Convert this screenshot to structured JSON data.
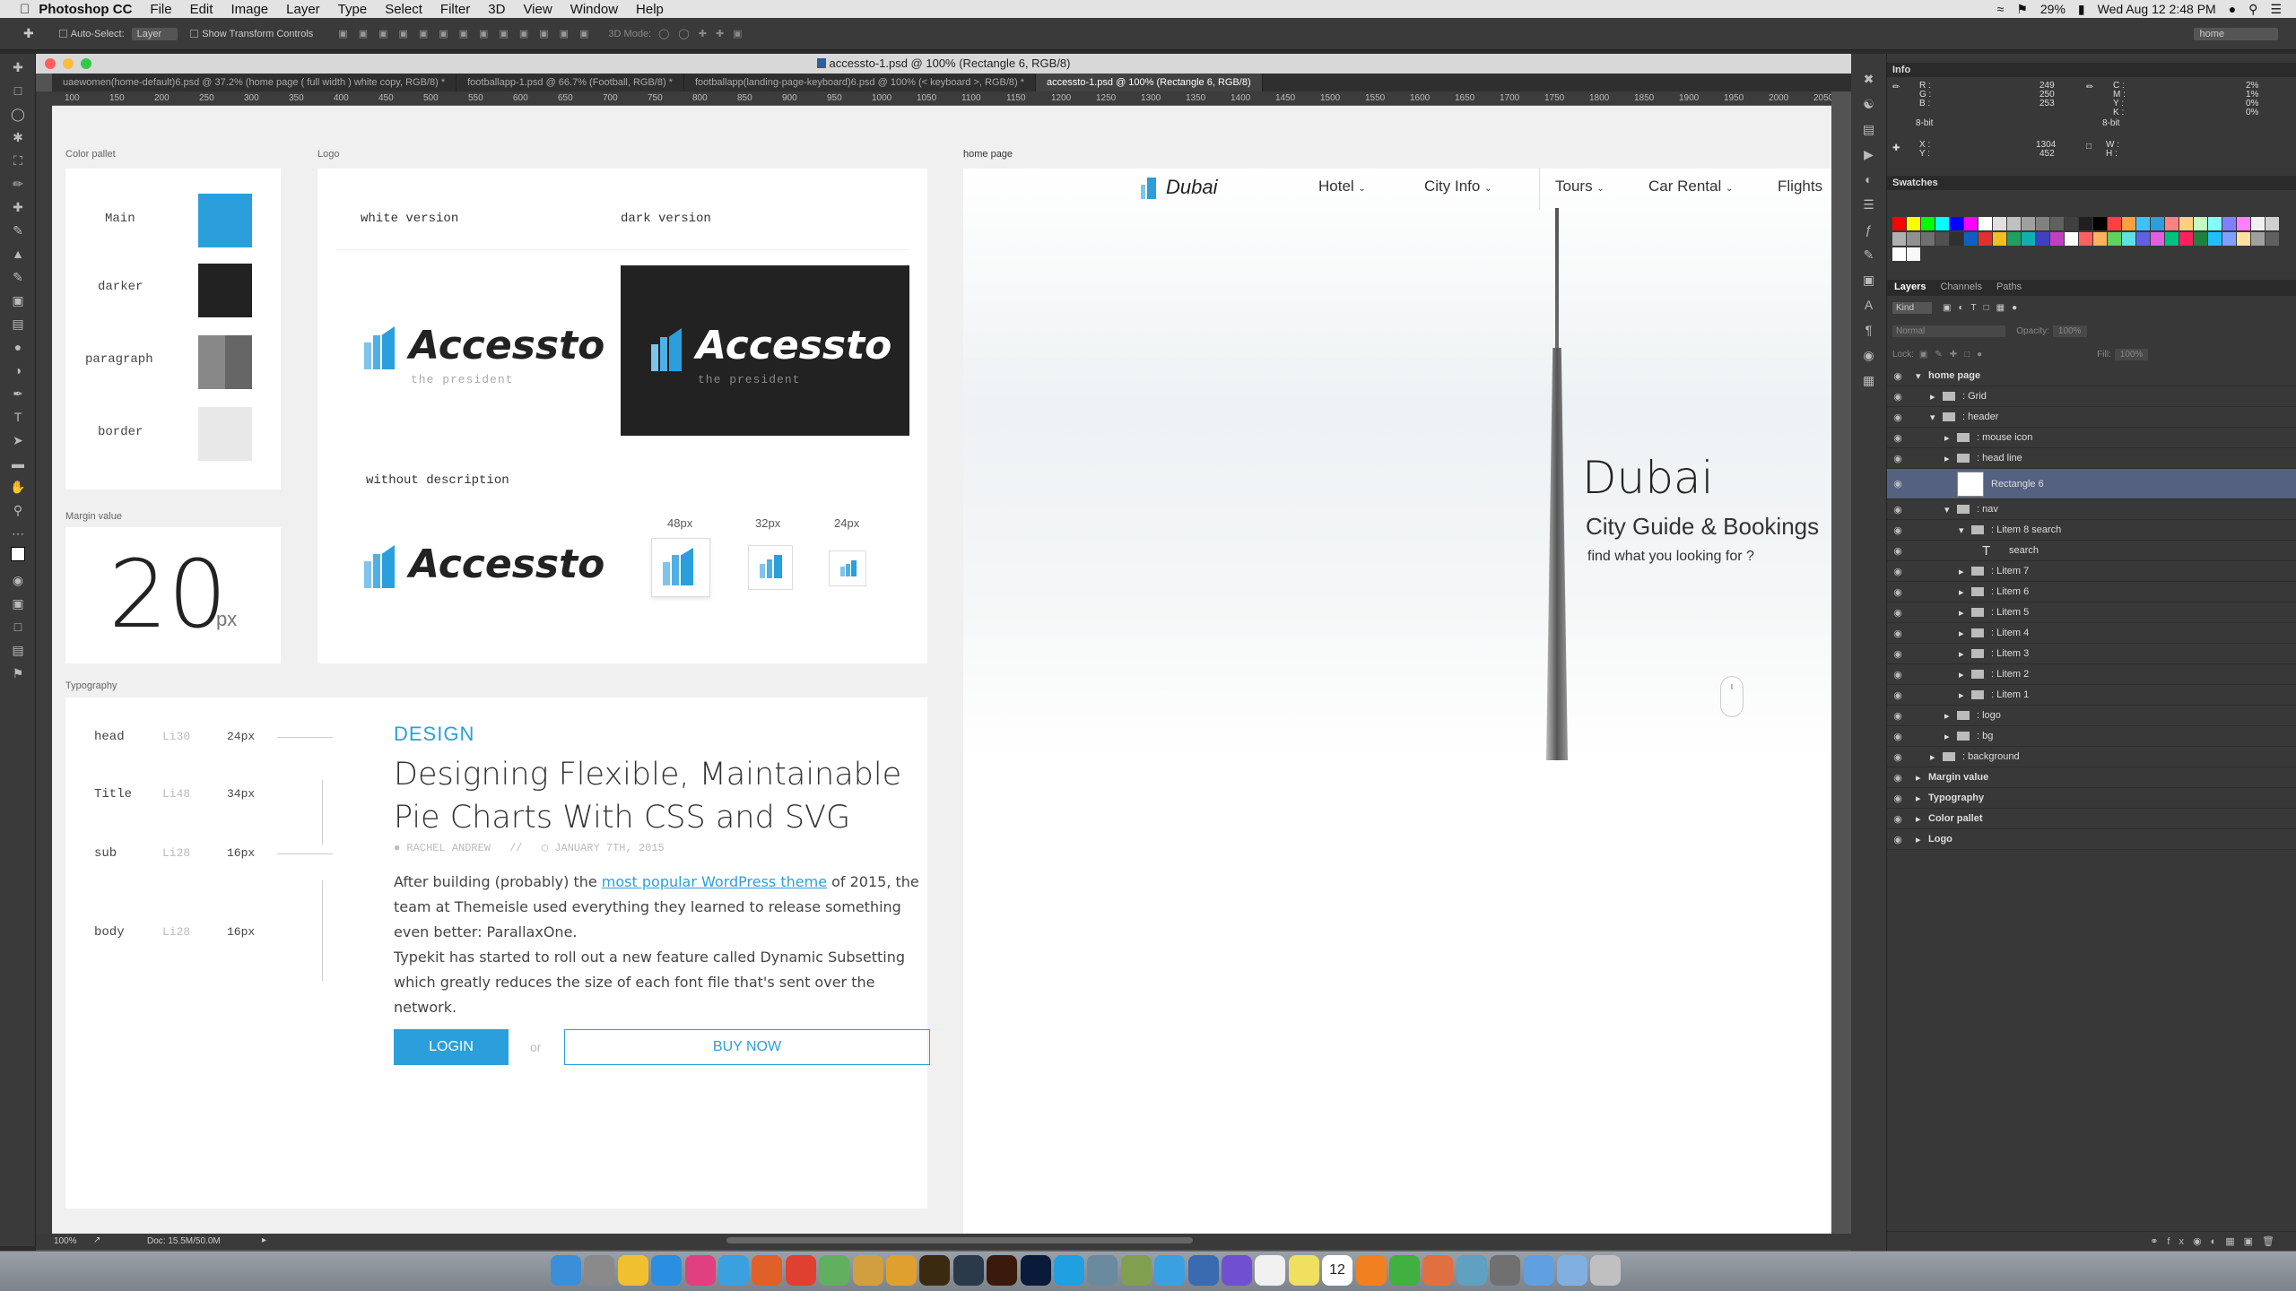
{
  "menubar": {
    "app_name": "Photoshop CC",
    "items": [
      "File",
      "Edit",
      "Image",
      "Layer",
      "Type",
      "Select",
      "Filter",
      "3D",
      "View",
      "Window",
      "Help"
    ],
    "battery": "29%",
    "datetime": "Wed Aug 12  2:48 PM"
  },
  "options_bar": {
    "auto_select_label": "Auto-Select:",
    "auto_select_value": "Layer",
    "transform_label": "Show Transform Controls",
    "mode_3d_label": "3D Mode:",
    "workspace_value": "home"
  },
  "document": {
    "title": "accessto-1.psd @ 100% (Rectangle 6, RGB/8)",
    "tabs": [
      {
        "label": "uaewomen(home-default)6.psd @ 37.2% (home page  (  full width  ) white copy, RGB/8) *",
        "active": false
      },
      {
        "label": "footballapp-1.psd @ 66.7% (Football, RGB/8) *",
        "active": false
      },
      {
        "label": "footballapp(landing-page-keyboard)6.psd @ 100% (<  keyboard  >, RGB/8) *",
        "active": false
      },
      {
        "label": "accessto-1.psd @ 100% (Rectangle 6, RGB/8)",
        "active": true
      }
    ],
    "ruler_ticks": [
      "100",
      "150",
      "200",
      "250",
      "300",
      "350",
      "400",
      "450",
      "500",
      "550",
      "600",
      "650",
      "700",
      "750",
      "800",
      "850",
      "900",
      "950",
      "1000",
      "1050",
      "1100",
      "1150",
      "1200",
      "1250",
      "1300",
      "1350",
      "1400",
      "1450",
      "1500",
      "1550",
      "1600",
      "1650",
      "1700",
      "1750",
      "1800",
      "1850",
      "1900",
      "1950",
      "2000",
      "2050"
    ],
    "zoom": "100%",
    "doc_size": "Doc: 15.5M/50.0M"
  },
  "artboard": {
    "color_pallet_label": "Color pallet",
    "colors": [
      {
        "name": "Main",
        "hex": "#2a9fdb"
      },
      {
        "name": "darker",
        "hex": "#222222"
      },
      {
        "name": "paragraph",
        "hex": "#8a8a8a"
      },
      {
        "name": "border",
        "hex": "#e8e8e8"
      }
    ],
    "logo_label": "Logo",
    "logo": {
      "white_version": "white version",
      "dark_version": "dark version",
      "brand": "Accessto",
      "tagline": "the president",
      "without_description": "without description",
      "sizes": [
        "48px",
        "32px",
        "24px"
      ],
      "brand_color": "#2a9fdb"
    },
    "margin_label": "Margin value",
    "margin_value": "20",
    "margin_unit": "px",
    "typography_label": "Typography",
    "typography": [
      {
        "name": "head",
        "lh": "Li30",
        "size": "24px"
      },
      {
        "name": "Title",
        "lh": "Li48",
        "size": "34px"
      },
      {
        "name": "sub",
        "lh": "Li28",
        "size": "16px"
      },
      {
        "name": "body",
        "lh": "Li28",
        "size": "16px"
      }
    ],
    "sample": {
      "head": "DESIGN",
      "title": "Designing Flexible, Maintainable Pie Charts With CSS and SVG",
      "author": "RACHEL ANDREW",
      "separator": "//",
      "date": "JANUARY 7TH, 2015",
      "body_before_link": "After building (probably) the ",
      "body_link": "most popular WordPress theme",
      "body_after_link": " of 2015, the team at Themeisle used everything they learned to release something even better: ParallaxOne.",
      "body_2": "Typekit has started to roll out a new feature called Dynamic Subsetting which greatly reduces the size of each font file that's sent over the network.",
      "login": "LOGIN",
      "or": "or",
      "buy_now": "BUY NOW"
    },
    "home_page_label": "home page",
    "home": {
      "brand": "Dubai",
      "nav": [
        "Hotel",
        "City Info",
        "Tours",
        "Car Rental",
        "Flights"
      ],
      "hero_title": "Dubai",
      "hero_subtitle": "City Guide & Bookings",
      "hero_tagline": "find what you looking for ?"
    }
  },
  "info_panel": {
    "title": "Info",
    "r": "249",
    "g": "250",
    "b": "253",
    "c": "2%",
    "m": "1%",
    "y": "0%",
    "k": "0%",
    "bit_left": "8-bit",
    "bit_right": "8-bit",
    "x": "1304",
    "y_coord": "452",
    "labels": {
      "r": "R :",
      "g": "G :",
      "b": "B :",
      "c": "C :",
      "m": "M :",
      "yl": "Y :",
      "k": "K :",
      "x": "X :",
      "yc": "Y :",
      "w": "W :",
      "h": "H :"
    }
  },
  "swatches_panel": {
    "title": "Swatches",
    "colors": [
      "#ff0000",
      "#ffff00",
      "#00ff00",
      "#00ffff",
      "#0000ff",
      "#ff00ff",
      "#ffffff",
      "#e0e0e0",
      "#c0c0c0",
      "#a0a0a0",
      "#808080",
      "#606060",
      "#404040",
      "#202020",
      "#000000",
      "#ff4040",
      "#ffa040",
      "#40c0ff",
      "#2a9fdb",
      "#ff8080",
      "#ffd080",
      "#c0ffc0",
      "#80ffff",
      "#8080ff",
      "#ff80ff",
      "#f0f0f0",
      "#d0d0d0",
      "#b0b0b0",
      "#909090",
      "#707070",
      "#505050",
      "#303030",
      "#1060c0",
      "#e03030",
      "#f0c020",
      "#20a060",
      "#10b0b0",
      "#4040c0",
      "#c040c0",
      "#ffffff",
      "#ff6060",
      "#ffb060",
      "#60d060",
      "#60e0e0",
      "#6060e0",
      "#e060e0",
      "#00c080",
      "#ff2060",
      "#208040",
      "#20c0ff",
      "#80a0ff",
      "#ffe0a0",
      "#a0a0a0",
      "#606060",
      "#ffffff",
      "#f8f8f8"
    ]
  },
  "layers_panel": {
    "tabs": [
      "Layers",
      "Channels",
      "Paths"
    ],
    "kind": "Kind",
    "blend": "Normal",
    "opacity_label": "Opacity:",
    "opacity": "100%",
    "lock_label": "Lock:",
    "fill_label": "Fill:",
    "fill": "100%",
    "layers": [
      {
        "name": "home page",
        "depth": 0,
        "type": "artboard",
        "selected": false
      },
      {
        "name": ": Grid",
        "depth": 1,
        "type": "folder",
        "selected": false
      },
      {
        "name": ": header",
        "depth": 1,
        "type": "folder-open",
        "selected": false
      },
      {
        "name": ": mouse icon",
        "depth": 2,
        "type": "folder",
        "selected": false
      },
      {
        "name": ": head line",
        "depth": 2,
        "type": "folder",
        "selected": false
      },
      {
        "name": "Rectangle 6",
        "depth": 2,
        "type": "shape",
        "selected": true
      },
      {
        "name": ": nav",
        "depth": 2,
        "type": "folder-open",
        "selected": false
      },
      {
        "name": ": Litem 8 search",
        "depth": 3,
        "type": "folder-open",
        "selected": false
      },
      {
        "name": "search",
        "depth": 4,
        "type": "text",
        "selected": false
      },
      {
        "name": ": Litem 7",
        "depth": 3,
        "type": "folder",
        "selected": false
      },
      {
        "name": ": Litem 6",
        "depth": 3,
        "type": "folder",
        "selected": false
      },
      {
        "name": ": Litem 5",
        "depth": 3,
        "type": "folder",
        "selected": false
      },
      {
        "name": ": Litem 4",
        "depth": 3,
        "type": "folder",
        "selected": false
      },
      {
        "name": ": Litem 3",
        "depth": 3,
        "type": "folder",
        "selected": false
      },
      {
        "name": ": Litem 2",
        "depth": 3,
        "type": "folder",
        "selected": false
      },
      {
        "name": ": Litem 1",
        "depth": 3,
        "type": "folder",
        "selected": false
      },
      {
        "name": ": logo",
        "depth": 2,
        "type": "folder",
        "selected": false
      },
      {
        "name": ": bg",
        "depth": 2,
        "type": "folder",
        "selected": false
      },
      {
        "name": ": background",
        "depth": 1,
        "type": "folder",
        "selected": false
      },
      {
        "name": "Margin value",
        "depth": 0,
        "type": "artboard-closed",
        "selected": false
      },
      {
        "name": "Typography",
        "depth": 0,
        "type": "artboard-closed",
        "selected": false
      },
      {
        "name": "Color pallet",
        "depth": 0,
        "type": "artboard-closed",
        "selected": false
      },
      {
        "name": "Logo",
        "depth": 0,
        "type": "artboard-closed",
        "selected": false
      }
    ]
  },
  "dock": {
    "apps": [
      "Finder",
      "Launchpad",
      "Notes",
      "App Store",
      "iTunes",
      "Safari",
      "Firefox",
      "Chrome",
      "Maps",
      "Photo",
      "Sketch",
      "Bridge",
      "Lightroom",
      "Illustrator",
      "Photoshop",
      "Skype",
      "Preview",
      "Keychain",
      "Twitter",
      "Xcode",
      "Siri",
      "TextEdit",
      "Stickies",
      "Calendar",
      "VLC",
      "uTorrent",
      "Photos",
      "Image Capture",
      "System Preferences",
      "Downloads",
      "Folder",
      "Trash"
    ],
    "calendar_day": "12"
  }
}
